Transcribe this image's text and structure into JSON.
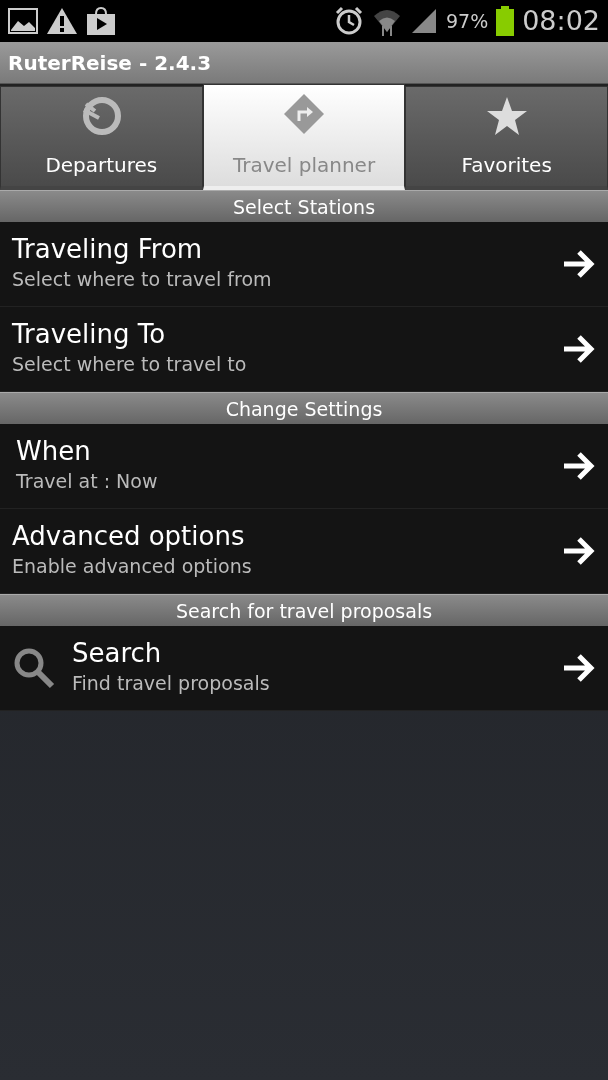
{
  "status_bar": {
    "battery": "97%",
    "time": "08:02"
  },
  "title": "RuterReise - 2.4.3",
  "tabs": [
    {
      "label": "Departures",
      "kind": "clock",
      "selected": false
    },
    {
      "label": "Travel planner",
      "kind": "sign",
      "selected": true
    },
    {
      "label": "Favorites",
      "kind": "star",
      "selected": false
    }
  ],
  "sections": [
    {
      "header": "Select Stations",
      "items": [
        {
          "title": "Traveling From",
          "subtitle": "Select where to travel from"
        },
        {
          "title": "Traveling To",
          "subtitle": "Select where to travel to"
        }
      ]
    },
    {
      "header": "Change Settings",
      "items": [
        {
          "title": "When",
          "subtitle": "Travel at : Now",
          "kind": "indented"
        },
        {
          "title": "Advanced options",
          "subtitle": "Enable advanced options"
        }
      ]
    },
    {
      "header": "Search for travel proposals",
      "items": [
        {
          "title": "Search",
          "subtitle": "Find travel proposals",
          "kind": "search"
        }
      ]
    }
  ]
}
